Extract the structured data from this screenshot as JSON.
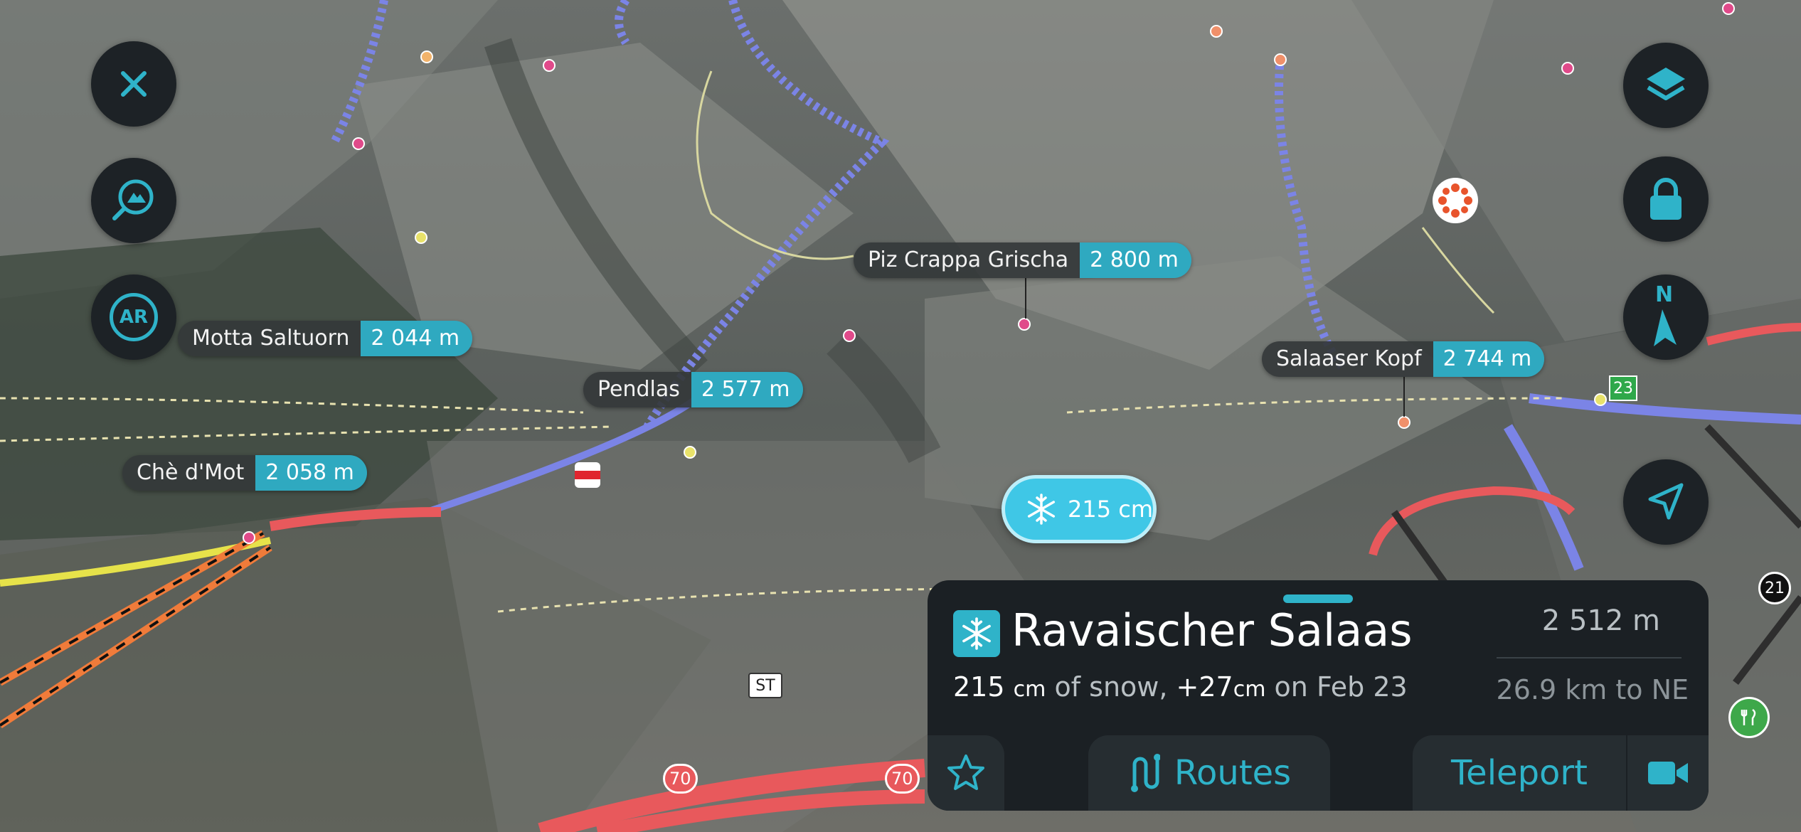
{
  "peaks": [
    {
      "name": "Piz Crappa Grischa",
      "elevation": "2 800 m"
    },
    {
      "name": "Motta Saltuorn",
      "elevation": "2 044 m"
    },
    {
      "name": "Pendlas",
      "elevation": "2 577 m"
    },
    {
      "name": "Chè d'Mot",
      "elevation": "2 058 m"
    },
    {
      "name": "Salaaser Kopf",
      "elevation": "2 744 m"
    }
  ],
  "left_controls": {
    "ar_label": "AR"
  },
  "compass": {
    "label": "N"
  },
  "snow_chip": {
    "value": "215 cm"
  },
  "markers": {
    "road_label": "ST",
    "route_23": "23",
    "route_21": "21",
    "route_70a": "70",
    "route_70b": "70"
  },
  "panel": {
    "title": "Ravaischer Salaas",
    "snow_depth_value": "215",
    "snow_depth_unit": "cm",
    "snow_text": "of snow,",
    "snow_new_value": "+27",
    "snow_new_unit": "cm",
    "snow_date_text": "on Feb 23",
    "elevation": "2 512 m",
    "distance": "26.9 km to NE",
    "routes_label": "Routes",
    "teleport_label": "Teleport"
  },
  "colors": {
    "accent": "#2fb3c9",
    "panel_bg": "#1b2024",
    "button_bg": "#1d2226",
    "piste_red": "#e8595c",
    "piste_blue": "#7b84e6"
  }
}
